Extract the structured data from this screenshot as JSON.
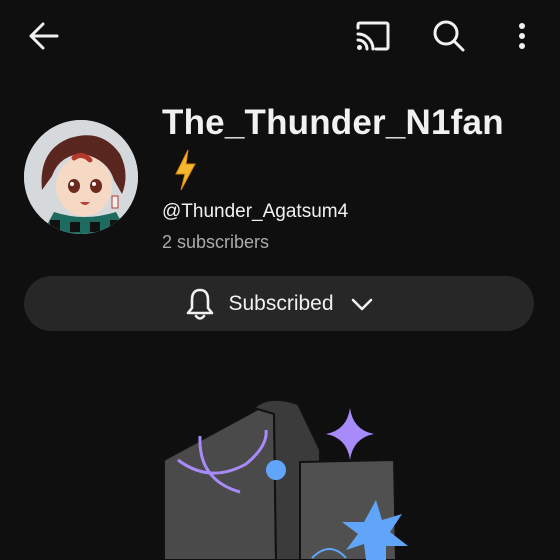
{
  "topbar": {
    "back_icon": "arrow-left-icon",
    "cast_icon": "cast-icon",
    "search_icon": "search-icon",
    "more_icon": "more-vertical-icon"
  },
  "channel": {
    "name": "The_Thunder_N1fan",
    "name_emoji": "lightning-bolt-emoji",
    "handle": "@Thunder_Agatsum4",
    "subscribers": "2 subscribers"
  },
  "subscribe_button": {
    "label": "Subscribed",
    "icon": "bell-icon",
    "dropdown_icon": "chevron-down-icon"
  },
  "colors": {
    "background": "#0f0f0f",
    "button_bg": "#272727",
    "text_primary": "#f1f1f1",
    "text_secondary": "#aaaaaa",
    "accent_purple": "#a78bfa",
    "accent_blue": "#60a5fa",
    "bolt_yellow": "#f5b82e"
  }
}
